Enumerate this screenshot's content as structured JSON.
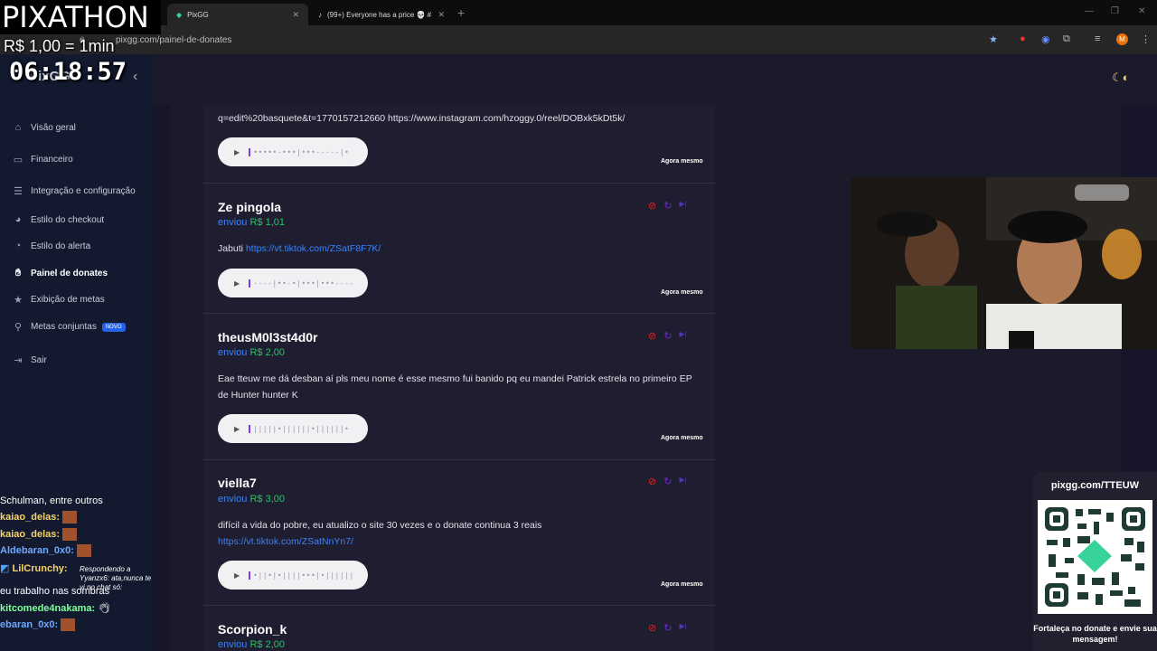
{
  "browser": {
    "tabs": [
      {
        "label": "PixGG",
        "favicon": "pixgg-logo-icon",
        "active": true
      },
      {
        "label": "(99+) Everyone has a price 💀 #",
        "favicon": "tiktok-icon",
        "active": false
      }
    ],
    "url": "pixgg.com/painel-de-donates",
    "new_tab": "+"
  },
  "overlay": {
    "title": "PIXATHON",
    "rate": "R$ 1,00 = 1min",
    "timer": "06:18:57"
  },
  "sidebar": {
    "items": [
      {
        "label": "Visão geral",
        "icon": "home-icon"
      },
      {
        "label": "Financeiro",
        "icon": "wallet-icon"
      },
      {
        "label": "Integração e configuração",
        "icon": "settings-sliders-icon"
      },
      {
        "label": "Estilo do checkout",
        "icon": "palette-icon"
      },
      {
        "label": "Estilo do alerta",
        "icon": "bell-palette-icon"
      },
      {
        "label": "Painel de donates",
        "icon": "donate-hand-icon",
        "active": true
      },
      {
        "label": "Exibição de metas",
        "icon": "star-icon"
      },
      {
        "label": "Metas conjuntas",
        "icon": "share-icon",
        "badge": "NOVO"
      },
      {
        "label": "Sair",
        "icon": "logout-icon"
      }
    ]
  },
  "donations": [
    {
      "message_line1": "q=edit%20basquete&t=1770157212660 https://www.instagram.com/hzoggy.0/reel/DOBxk5kDt5k/",
      "wave": "•••••-•••|•••--·--|•",
      "time": "Agora mesmo"
    },
    {
      "donor": "Ze pingola",
      "sent_label": "enviou",
      "amount": "R$ 1,01",
      "message": "Jabuti",
      "link": "https://vt.tiktok.com/ZSatF8F7K/",
      "wave": "·---|••-•|•••|•••----",
      "time": "Agora mesmo"
    },
    {
      "donor": "theusM0l3st4d0r",
      "sent_label": "enviou",
      "amount": "R$ 2,00",
      "message": "Eae tteuw me dá desban aí pls meu nome é esse mesmo fui banido pq eu mandei Patrick estrela no primeiro EP de Hunter hunter K",
      "wave": "|||||•||||||•||||||•",
      "time": "Agora mesmo"
    },
    {
      "donor": "viella7",
      "sent_label": "enviou",
      "amount": "R$ 3,00",
      "message": "difícil a vida do pobre, eu atualizo o site 30 vezes e o donate continua 3 reais",
      "link": "https://vt.tiktok.com/ZSatNnYn7/",
      "wave": "•||•|•||||•••|•||||||",
      "time": "Agora mesmo"
    },
    {
      "donor": "Scorpion_k",
      "sent_label": "enviou",
      "amount": "R$ 2,00"
    }
  ],
  "chat": [
    {
      "text": "Schulman, entre outros",
      "color": "#ffffff"
    },
    {
      "user": "kaiao_delas:",
      "color": "#f5d36a",
      "emote": "emote-face-icon"
    },
    {
      "user": "kaiao_delas:",
      "color": "#f5d36a",
      "emote": "emote-face-icon"
    },
    {
      "user": "Aldebaran_0x0:",
      "color": "#6fa8ff",
      "emote": "emote-face-icon"
    },
    {
      "user": "LilCrunchy:",
      "color": "#f5d36a",
      "reply": "Respondendo a Yyanzx6: ata,nunca te vi no chat só:",
      "text": "eu trabalho nas sombras"
    },
    {
      "user": "kitcomede4nakama:",
      "color": "#7fff9a",
      "emote": "emote-hand-icon"
    },
    {
      "user": "ebaran_0x0:",
      "color": "#6fa8ff",
      "emote": "emote-face-icon"
    }
  ],
  "qr_card": {
    "url": "pixgg.com/TTEUW",
    "text": "Fortaleça no donate e envie sua mensagem!"
  },
  "colors": {
    "accent": "#3b82f6",
    "amount": "#22c55e",
    "ban": "#dc2626",
    "sidebar_bg": "#131a30",
    "content_bg": "#1b1a2b"
  }
}
